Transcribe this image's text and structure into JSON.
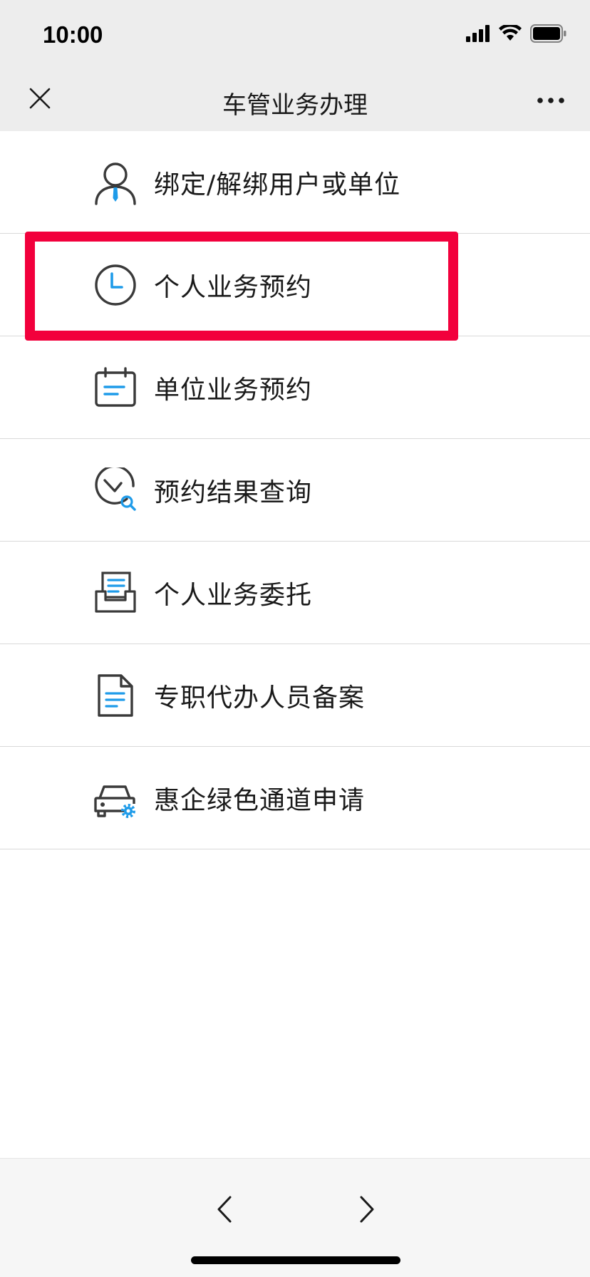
{
  "status_bar": {
    "time": "10:00",
    "icons": [
      "signal-icon",
      "wifi-icon",
      "battery-icon"
    ]
  },
  "nav_bar": {
    "title": "车管业务办理",
    "close_icon": "close-icon",
    "more_icon": "more-icon"
  },
  "menu": {
    "items": [
      {
        "label": "绑定/解绑用户或单位",
        "icon": "user-icon"
      },
      {
        "label": "个人业务预约",
        "icon": "clock-icon"
      },
      {
        "label": "单位业务预约",
        "icon": "calendar-icon"
      },
      {
        "label": "预约结果查询",
        "icon": "clock-search-icon"
      },
      {
        "label": "个人业务委托",
        "icon": "inbox-tray-icon"
      },
      {
        "label": "专职代办人员备案",
        "icon": "document-icon"
      },
      {
        "label": "惠企绿色通道申请",
        "icon": "car-gear-icon"
      }
    ],
    "highlighted_index": 1
  },
  "bottom_bar": {
    "back_icon": "chevron-left-icon",
    "forward_icon": "chevron-right-icon"
  },
  "colors": {
    "accent_blue": "#1e9be9",
    "icon_dark": "#3a3a3a",
    "highlight_red": "#f2003c",
    "bar_gray": "#ededed"
  }
}
